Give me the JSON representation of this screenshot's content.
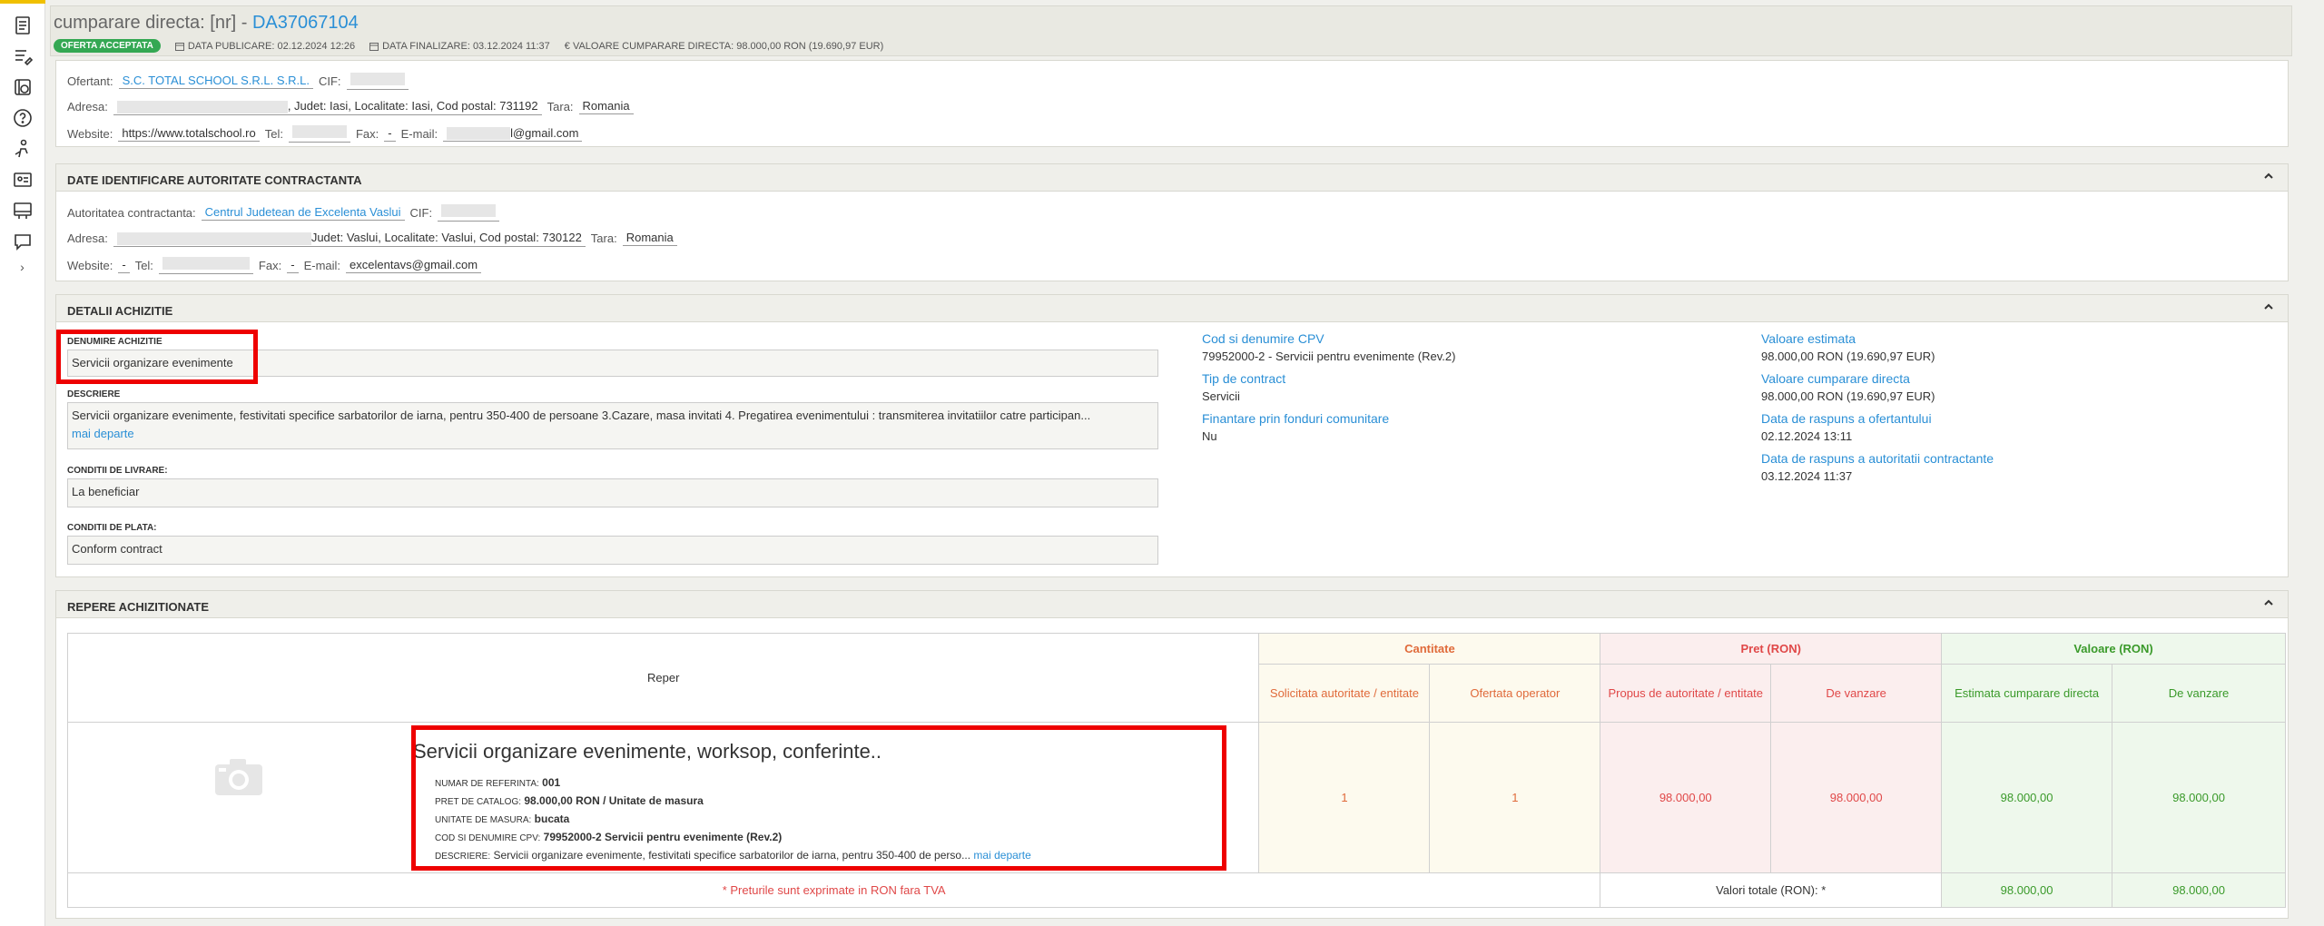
{
  "sidebar": {
    "icons": [
      "document-icon",
      "list-edit-icon",
      "ledger-icon",
      "help-icon",
      "user-hand-icon",
      "id-card-icon",
      "receipt-icon",
      "chat-icon"
    ],
    "expand": "›"
  },
  "header": {
    "title_prefix": "cumparare directa: [nr] - ",
    "title_code": "DA37067104",
    "badge": "OFERTA ACCEPTATA",
    "data_publicare": "DATA PUBLICARE: 02.12.2024 12:26",
    "data_finalizare": "DATA FINALIZARE: 03.12.2024 11:37",
    "valoare": "€ VALOARE CUMPARARE DIRECTA: 98.000,00  RON (19.690,97  EUR)"
  },
  "ofertant": {
    "label_ofertant": "Ofertant:",
    "name": "S.C. TOTAL SCHOOL S.R.L. S.R.L.",
    "label_cif": "CIF:",
    "label_adresa": "Adresa:",
    "adresa_tail": ", Judet: Iasi, Localitate: Iasi, Cod postal: 731192",
    "label_tara": "Tara:",
    "tara": "Romania",
    "label_website": "Website:",
    "website": "https://www.totalschool.ro",
    "label_tel": "Tel:",
    "label_fax": "Fax:",
    "fax": "-",
    "label_email": "E-mail:",
    "email_tail": "l@gmail.com"
  },
  "autoritate": {
    "section_title": "DATE IDENTIFICARE AUTORITATE CONTRACTANTA",
    "label_autoritate": "Autoritatea contractanta:",
    "name": "Centrul Judetean de Excelenta Vaslui",
    "label_cif": "CIF:",
    "label_adresa": "Adresa:",
    "adresa_tail": "Judet: Vaslui, Localitate: Vaslui, Cod postal: 730122",
    "label_tara": "Tara:",
    "tara": "Romania",
    "label_website": "Website:",
    "website": "-",
    "label_tel": "Tel:",
    "label_fax": "Fax:",
    "fax": "-",
    "label_email": "E-mail:",
    "email": "excelentavs@gmail.com"
  },
  "detalii": {
    "section_title": "DETALII ACHIZITIE",
    "denumire_label": "DENUMIRE ACHIZITIE",
    "denumire": "Servicii organizare evenimente",
    "descriere_label": "DESCRIERE",
    "descriere": "Servicii organizare evenimente, festivitati specifice sarbatorilor de iarna, pentru 350-400 de persoane 3.Cazare, masa invitati 4. Pregatirea evenimentului : transmiterea invitatiilor catre participan...",
    "mai_departe": "mai departe",
    "livrare_label": "CONDITII DE LIVRARE:",
    "livrare": "La beneficiar",
    "plata_label": "CONDITII DE PLATA:",
    "plata": "Conform contract",
    "cpv_label": "Cod si denumire CPV",
    "cpv": "79952000-2 - Servicii pentru evenimente (Rev.2)",
    "tip_label": "Tip de contract",
    "tip": "Servicii",
    "fonduri_label": "Finantare prin fonduri comunitare",
    "fonduri": "Nu",
    "val_est_label": "Valoare estimata",
    "val_est": "98.000,00  RON (19.690,97  EUR)",
    "val_cd_label": "Valoare cumparare directa",
    "val_cd": "98.000,00  RON (19.690,97  EUR)",
    "raspuns_of_label": "Data de raspuns a ofertantului",
    "raspuns_of": "02.12.2024 13:11",
    "raspuns_aut_label": "Data de raspuns a autoritatii contractante",
    "raspuns_aut": "03.12.2024 11:37"
  },
  "repere": {
    "section_title": "REPERE ACHIZITIONATE",
    "col_reper": "Reper",
    "col_cantitate": "Cantitate",
    "col_pret": "Pret (RON)",
    "col_valoare": "Valoare (RON)",
    "sub_solicitata": "Solicitata autoritate / entitate",
    "sub_ofertata": "Ofertata operator",
    "sub_propus": "Propus de autoritate / entitate",
    "sub_vanzare_pret": "De vanzare",
    "sub_estimata": "Estimata cumparare directa",
    "sub_vanzare_val": "De vanzare",
    "item": {
      "name": "Servicii organizare evenimente, worksop, conferinte..",
      "ref_label": "NUMAR DE REFERINTA:",
      "ref": "001",
      "pret_label": "PRET DE CATALOG:",
      "pret": "98.000,00  RON / Unitate de masura",
      "um_label": "UNITATE DE MASURA:",
      "um": "bucata",
      "cpv_label": "COD SI DENUMIRE CPV:",
      "cpv": "79952000-2 Servicii pentru evenimente (Rev.2)",
      "desc_label": "DESCRIERE:",
      "desc": "Servicii organizare evenimente, festivitati specifice sarbatorilor de iarna, pentru 350-400 de perso...",
      "mai_departe": "mai departe",
      "solicitata": "1",
      "ofertata": "1",
      "propus": "98.000,00",
      "vanzare_pret": "98.000,00",
      "estimata": "98.000,00",
      "vanzare_val": "98.000,00"
    },
    "footnote": "* Preturile sunt exprimate in RON fara TVA",
    "totals_label": "Valori totale (RON): *",
    "total_estimata": "98.000,00",
    "total_vanzare": "98.000,00"
  }
}
